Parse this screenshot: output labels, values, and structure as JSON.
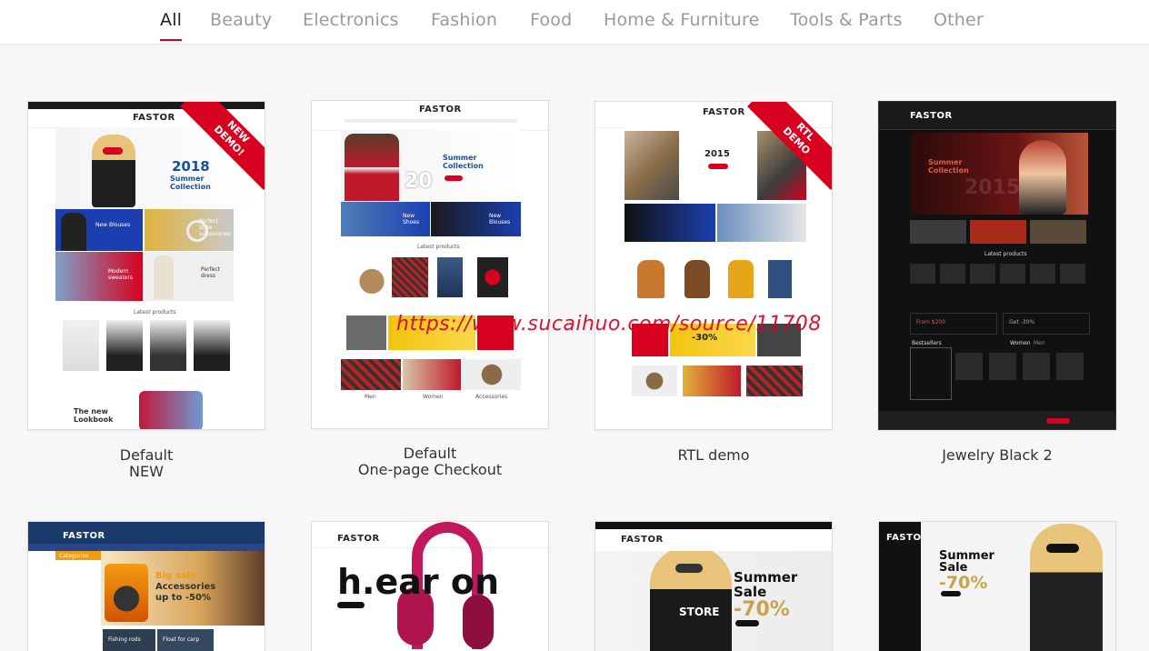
{
  "tabs": [
    {
      "label": "All"
    },
    {
      "label": "Beauty"
    },
    {
      "label": "Electronics"
    },
    {
      "label": "Fashion"
    },
    {
      "label": "Food"
    },
    {
      "label": "Home & Furniture"
    },
    {
      "label": "Tools & Parts"
    },
    {
      "label": "Other"
    }
  ],
  "active_tab": "All",
  "colors": {
    "accent": "#d7001e",
    "text": "#333333",
    "muted": "#9a9a9a",
    "background": "#f7f7f7"
  },
  "demos": [
    {
      "caption": [
        "Default",
        "NEW"
      ],
      "ribbon": [
        "NEW",
        "DEMO!"
      ],
      "logo": "FASTOR",
      "hero_year": "2018",
      "hero_title": [
        "Summer",
        "Collection"
      ],
      "tile_labels": [
        "New Blouses",
        "Perfect style accessories",
        "Modern sweaters",
        "Perfect dress"
      ],
      "section_title": "Latest products",
      "lookbook": [
        "The new",
        "Lookbook"
      ]
    },
    {
      "caption": [
        "Default",
        "One-page Checkout"
      ],
      "logo": "FASTOR",
      "hero_title": [
        "Summer",
        "Collection"
      ],
      "hero_number": "20",
      "tile_labels": [
        "New Shoes",
        "New Blouses"
      ],
      "section_title": "Latest products",
      "category_labels": [
        "Men",
        "Women",
        "Accessories"
      ]
    },
    {
      "caption": [
        "RTL demo"
      ],
      "ribbon": [
        "RTL",
        "DEMO"
      ],
      "logo": "FASTOR",
      "hero_year": "2015",
      "sale_text": "-30%"
    },
    {
      "caption": [
        "Jewelry Black 2"
      ],
      "logo": "FASTOR",
      "hero_title": [
        "Summer",
        "Collection"
      ],
      "hero_year": "2015",
      "section_title": "Latest products",
      "promo_left": "From $200",
      "promo_right": "Get -30%",
      "tabs_small": [
        "Bestsellers",
        "Women",
        "Men"
      ]
    },
    {
      "caption": [],
      "logo": "FASTOR",
      "sidebar_title": "Categories",
      "hero_title": [
        "Big sale",
        "Accessories",
        "up to -50%"
      ],
      "tile_labels": [
        "Fishing rods",
        "Float for carp"
      ]
    },
    {
      "caption": [],
      "logo": "FASTOR",
      "hero_title": "h.ear on"
    },
    {
      "caption": [],
      "logo": "FASTOR",
      "hero_title": [
        "Summer",
        "Sale"
      ],
      "sale_text": "-70%",
      "shirt_text": "STORE"
    },
    {
      "caption": [],
      "logo": "FASTOR",
      "hero_title": [
        "Summer",
        "Sale"
      ],
      "sale_text": "-70%"
    }
  ],
  "watermark": "https://www.sucaihuo.com/source/11708"
}
